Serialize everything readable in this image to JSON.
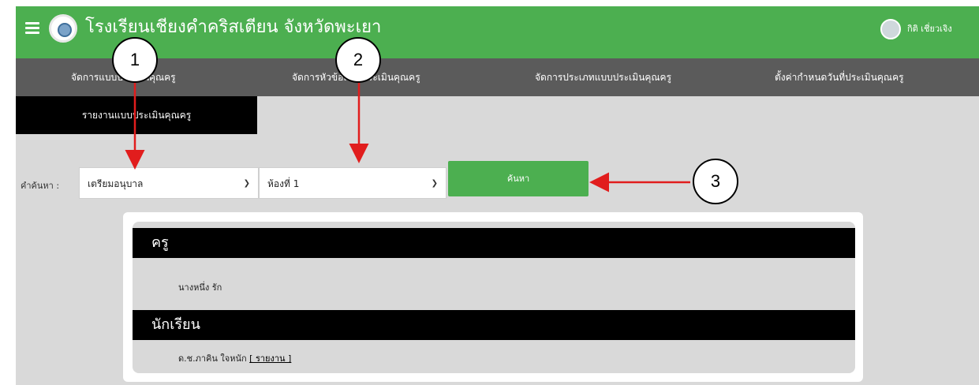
{
  "header": {
    "title": "โรงเรียนเชียงคำคริสเตียน จังหวัดพะเยา",
    "user_name": "กิติ เชี่ยวเจิง",
    "accent_color": "#4caf50"
  },
  "menu": {
    "items": [
      {
        "label": "จัดการแบบประเมินคุณครู"
      },
      {
        "label": "จัดการหัวข้อแบบประเมินคุณครู"
      },
      {
        "label": "จัดการประเภทแบบประเมินคุณครู"
      },
      {
        "label": "ตั้งค่ากำหนดวันที่ประเมินคุณครู"
      }
    ],
    "active": "รายงานแบบประเมินคุณครู"
  },
  "search": {
    "label": "คำค้นหา :",
    "level_selected": "เตรียมอนุบาล",
    "room_selected": "ห้องที่ 1",
    "button_label": "ค้นหา"
  },
  "results": {
    "teacher_heading": "ครู",
    "teacher_name": "นางหนึ่ง รัก",
    "student_heading": "นักเรียน",
    "student_name": "ด.ช.ภาคิน ใจหนัก",
    "report_link": "[ รายงาน ]"
  },
  "annotations": [
    "1",
    "2",
    "3"
  ]
}
